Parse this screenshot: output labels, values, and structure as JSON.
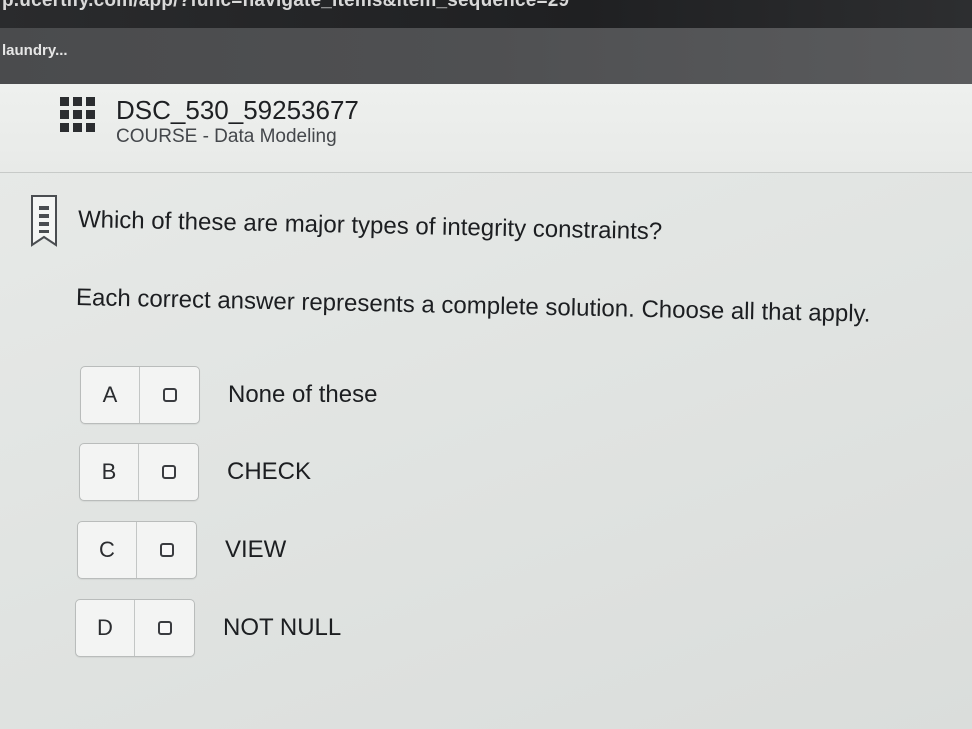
{
  "browser": {
    "url": "p.ucertify.com/app/?func=navigate_items&item_sequence=29",
    "tab_label": "laundry..."
  },
  "course": {
    "menu_icon": "grid-menu-icon",
    "title": "DSC_530_59253677",
    "subtitle": "COURSE - Data Modeling"
  },
  "question": {
    "bookmark_icon": "bookmark-icon",
    "text": "Which of these are major types of integrity constraints?",
    "instruction": "Each correct answer represents a complete solution. Choose all that apply.",
    "options": [
      {
        "letter": "A",
        "text": "None of these",
        "checked": false
      },
      {
        "letter": "B",
        "text": "CHECK",
        "checked": false
      },
      {
        "letter": "C",
        "text": "VIEW",
        "checked": false
      },
      {
        "letter": "D",
        "text": "NOT NULL",
        "checked": false
      }
    ]
  }
}
